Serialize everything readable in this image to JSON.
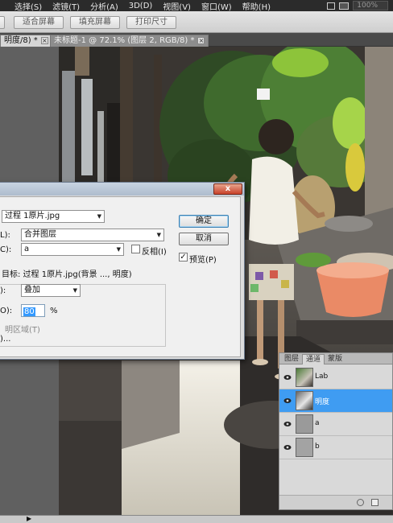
{
  "menubar": {
    "items": [
      "选择(S)",
      "滤镜(T)",
      "分析(A)",
      "3D(D)",
      "视图(V)",
      "窗口(W)",
      "帮助(H)"
    ],
    "zoom": "100%"
  },
  "options": {
    "buttons": [
      "适合屏幕",
      "填充屏幕",
      "打印尺寸"
    ]
  },
  "tabs": [
    {
      "label": "明度/8) *",
      "active": true
    },
    {
      "label": "未标题-1 @ 72.1% (图层 2, RGB/8) *",
      "active": false
    }
  ],
  "dialog": {
    "close": "x",
    "source_value": "过程 1原片.jpg",
    "layer_label": "L):",
    "layer_value": "合并图层",
    "channel_label": "C):",
    "channel_value": "a",
    "invert_label": "反相(I)",
    "target_text": "目标: 过程 1原片.jpg(背景 ..., 明度)",
    "blend_label": "):",
    "blend_value": "叠加",
    "opacity_label": "O):",
    "opacity_value": "80",
    "opacity_unit": "%",
    "preserve_label": "明区域(T)",
    "mask_label": ")...",
    "ok": "确定",
    "cancel": "取消",
    "preview_label": "预览(P)",
    "preview_checked": true
  },
  "panel": {
    "tabs": [
      "图层",
      "通道",
      "蒙版"
    ],
    "active_tab": "通道",
    "channels": [
      {
        "name": "Lab",
        "selected": false
      },
      {
        "name": "明度",
        "selected": true
      },
      {
        "name": "a",
        "selected": false
      },
      {
        "name": "b",
        "selected": false
      }
    ]
  }
}
